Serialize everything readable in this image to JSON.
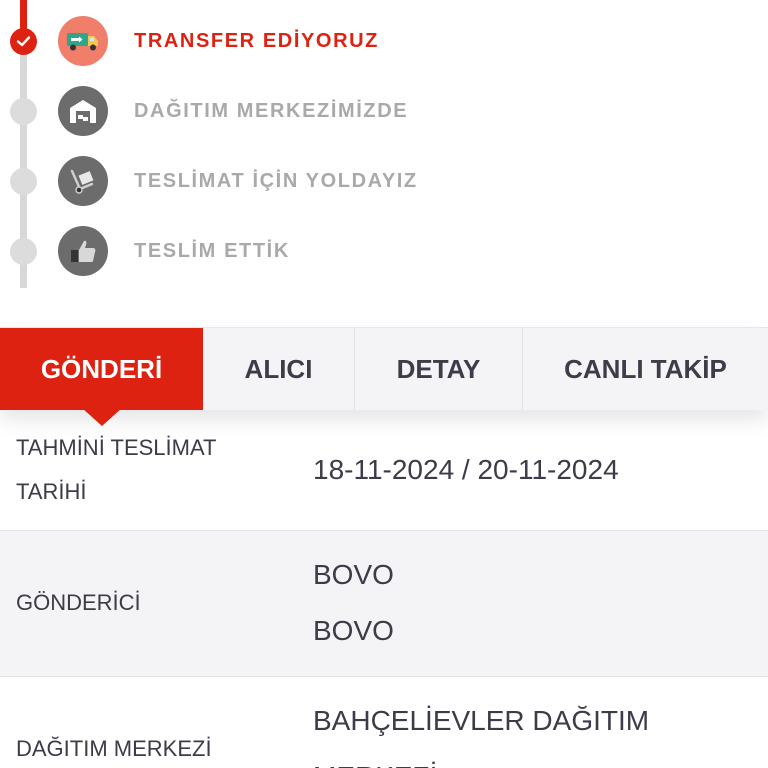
{
  "timeline": {
    "steps": [
      {
        "label": "TRANSFER EDİYORUZ",
        "icon": "truck-icon",
        "status": "completed"
      },
      {
        "label": "DAĞITIM MERKEZİMİZDE",
        "icon": "warehouse-icon",
        "status": "pending"
      },
      {
        "label": "TESLİMAT İÇİN YOLDAYIZ",
        "icon": "hand-truck-icon",
        "status": "pending"
      },
      {
        "label": "TESLİM ETTİK",
        "icon": "thumbs-up-icon",
        "status": "pending"
      }
    ],
    "active_color": "#dd2211",
    "inactive_color": "#a9a9a9"
  },
  "tabs": [
    {
      "label": "GÖNDERİ",
      "active": true
    },
    {
      "label": "ALICI",
      "active": false
    },
    {
      "label": "DETAY",
      "active": false
    },
    {
      "label": "CANLI TAKİP",
      "active": false
    }
  ],
  "details": {
    "estimated_delivery": {
      "label_line1": "TAHMİNİ TESLİMAT",
      "label_line2": "TARİHİ",
      "value": "18-11-2024 / 20-11-2024"
    },
    "sender": {
      "label": "GÖNDERİCİ",
      "value_line1": "BOVO",
      "value_line2": "BOVO"
    },
    "distribution_center": {
      "label": "DAĞITIM MERKEZİ",
      "value_line1": "BAHÇELİEVLER DAĞITIM",
      "value_line2": "MERKEZİ"
    }
  }
}
